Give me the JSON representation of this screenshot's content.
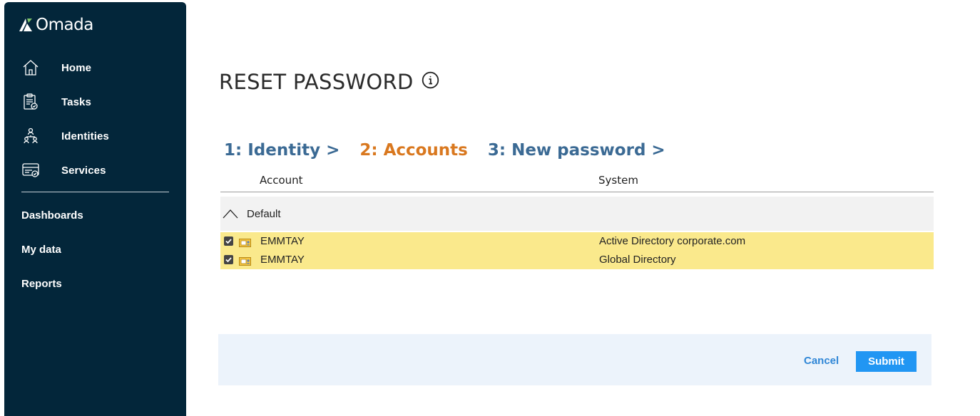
{
  "app": {
    "name": "Omada"
  },
  "sidebar": {
    "items": [
      {
        "label": "Home",
        "icon": "home-icon"
      },
      {
        "label": "Tasks",
        "icon": "tasks-icon"
      },
      {
        "label": "Identities",
        "icon": "identities-icon"
      },
      {
        "label": "Services",
        "icon": "services-icon"
      }
    ],
    "secondary": [
      "Dashboards",
      "My data",
      "Reports"
    ]
  },
  "page": {
    "title": "RESET PASSWORD",
    "info_icon": "info-icon"
  },
  "steps": [
    {
      "label": "1: Identity >",
      "state": "done"
    },
    {
      "label": "2: Accounts",
      "state": "active"
    },
    {
      "label": "3: New password >",
      "state": "todo"
    }
  ],
  "table": {
    "columns": [
      "Account",
      "System"
    ],
    "group": "Default",
    "rows": [
      {
        "checked": true,
        "account": "EMMTAY",
        "system": "Active Directory corporate.com"
      },
      {
        "checked": true,
        "account": "EMMTAY",
        "system": "Global Directory"
      }
    ]
  },
  "footer": {
    "cancel_label": "Cancel",
    "submit_label": "Submit"
  },
  "colors": {
    "sidebar_bg": "#03263a",
    "step_done": "#3b6a94",
    "step_active": "#d9781f",
    "row_highlight": "#fae98c",
    "submit_bg": "#2196f3"
  }
}
